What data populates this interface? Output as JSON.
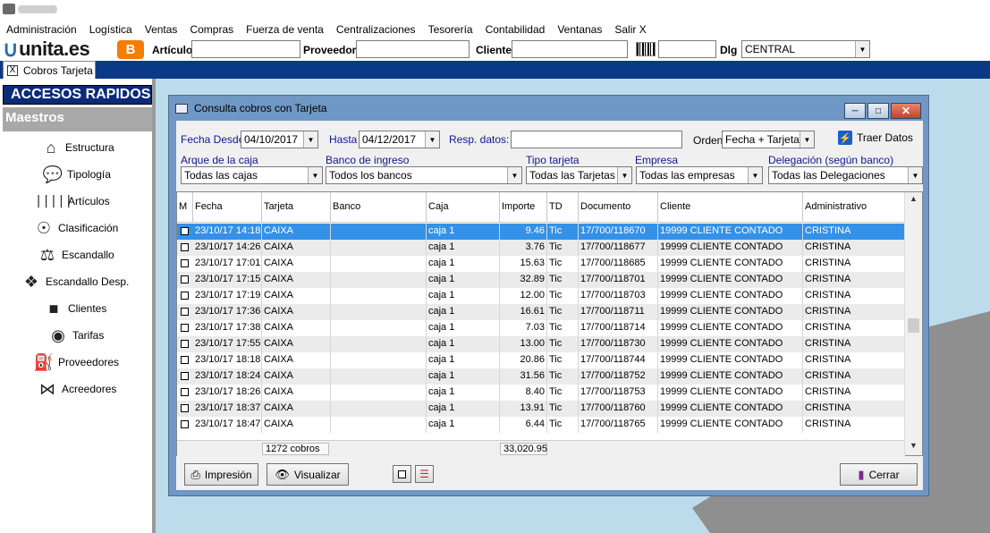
{
  "menubar": [
    "Administración",
    "Logística",
    "Ventas",
    "Compras",
    "Fuerza de venta",
    "Centralizaciones",
    "Tesorería",
    "Contabilidad",
    "Ventanas",
    "Salir X"
  ],
  "toolbar": {
    "logo_text": "unita.es",
    "blogger_glyph": "B",
    "articulo_label": "Artículo",
    "proveedor_label": "Proveedor",
    "cliente_label": "Cliente",
    "dlg_label": "Dlg",
    "dlg_value": "CENTRAL"
  },
  "tab": {
    "label": "Cobros Tarjeta",
    "close_glyph": "X"
  },
  "sidebar": {
    "header": "ACCESOS RAPIDOS",
    "section": "Maestros",
    "items": [
      {
        "label": "Estructura",
        "icon": "house-icon"
      },
      {
        "label": "Tipología",
        "icon": "chat-icon"
      },
      {
        "label": "Artículos",
        "icon": "barcode-icon"
      },
      {
        "label": "Clasificación",
        "icon": "compass-icon"
      },
      {
        "label": "Escandallo",
        "icon": "flask-icon"
      },
      {
        "label": "Escandallo Desp.",
        "icon": "puzzle-icon"
      },
      {
        "label": "Clientes",
        "icon": "briefcase-icon"
      },
      {
        "label": "Tarifas",
        "icon": "disc-icon"
      },
      {
        "label": "Proveedores",
        "icon": "fuel-icon"
      },
      {
        "label": "Acreedores",
        "icon": "bowtie-icon"
      }
    ]
  },
  "window": {
    "title": "Consulta cobros con Tarjeta",
    "fecha_desde_label": "Fecha Desde",
    "fecha_desde": "04/10/2017",
    "hasta_label": "Hasta",
    "hasta": "04/12/2017",
    "resp_label": "Resp. datos:",
    "resp_value": "",
    "orden_label": "Orden",
    "orden_value": "Fecha + Tarjeta",
    "traer_label": "Traer Datos",
    "arque_label": "Arque de la caja",
    "arque_value": "Todas las cajas",
    "banco_label": "Banco de ingreso",
    "banco_value": "Todos los bancos",
    "tipo_label": "Tipo tarjeta",
    "tipo_value": "Todas las Tarjetas",
    "empresa_label": "Empresa",
    "empresa_value": "Todas las empresas",
    "delegacion_label": "Delegación (según banco)",
    "delegacion_value": "Todas las Delegaciones"
  },
  "grid": {
    "columns": [
      "M",
      "Fecha",
      "Tarjeta",
      "Banco",
      "Caja",
      "Importe",
      "TD",
      "Documento",
      "Cliente",
      "Administrativo"
    ],
    "rows": [
      [
        "23/10/17 14:18",
        "CAIXA",
        "",
        "caja 1",
        "9.46",
        "Tic",
        "17/700/118670",
        "19999 CLIENTE CONTADO",
        "CRISTINA"
      ],
      [
        "23/10/17 14:26",
        "CAIXA",
        "",
        "caja 1",
        "3.76",
        "Tic",
        "17/700/118677",
        "19999 CLIENTE CONTADO",
        "CRISTINA"
      ],
      [
        "23/10/17 17:01",
        "CAIXA",
        "",
        "caja 1",
        "15.63",
        "Tic",
        "17/700/118685",
        "19999 CLIENTE CONTADO",
        "CRISTINA"
      ],
      [
        "23/10/17 17:15",
        "CAIXA",
        "",
        "caja 1",
        "32.89",
        "Tic",
        "17/700/118701",
        "19999 CLIENTE CONTADO",
        "CRISTINA"
      ],
      [
        "23/10/17 17:19",
        "CAIXA",
        "",
        "caja 1",
        "12.00",
        "Tic",
        "17/700/118703",
        "19999 CLIENTE CONTADO",
        "CRISTINA"
      ],
      [
        "23/10/17 17:36",
        "CAIXA",
        "",
        "caja 1",
        "16.61",
        "Tic",
        "17/700/118711",
        "19999 CLIENTE CONTADO",
        "CRISTINA"
      ],
      [
        "23/10/17 17:38",
        "CAIXA",
        "",
        "caja 1",
        "7.03",
        "Tic",
        "17/700/118714",
        "19999 CLIENTE CONTADO",
        "CRISTINA"
      ],
      [
        "23/10/17 17:55",
        "CAIXA",
        "",
        "caja 1",
        "13.00",
        "Tic",
        "17/700/118730",
        "19999 CLIENTE CONTADO",
        "CRISTINA"
      ],
      [
        "23/10/17 18:18",
        "CAIXA",
        "",
        "caja 1",
        "20.86",
        "Tic",
        "17/700/118744",
        "19999 CLIENTE CONTADO",
        "CRISTINA"
      ],
      [
        "23/10/17 18:24",
        "CAIXA",
        "",
        "caja 1",
        "31.56",
        "Tic",
        "17/700/118752",
        "19999 CLIENTE CONTADO",
        "CRISTINA"
      ],
      [
        "23/10/17 18:26",
        "CAIXA",
        "",
        "caja 1",
        "8.40",
        "Tic",
        "17/700/118753",
        "19999 CLIENTE CONTADO",
        "CRISTINA"
      ],
      [
        "23/10/17 18:37",
        "CAIXA",
        "",
        "caja 1",
        "13.91",
        "Tic",
        "17/700/118760",
        "19999 CLIENTE CONTADO",
        "CRISTINA"
      ],
      [
        "23/10/17 18:47",
        "CAIXA",
        "",
        "caja 1",
        "6.44",
        "Tic",
        "17/700/118765",
        "19999 CLIENTE CONTADO",
        "CRISTINA"
      ]
    ],
    "selected_row": 0,
    "footer_count": "1272 cobros",
    "footer_total": "33,020.95"
  },
  "buttons": {
    "impresion": "Impresión",
    "visualizar": "Visualizar",
    "cerrar": "Cerrar"
  },
  "colors": {
    "accent_dark_blue": "#0a3a86",
    "selection_blue": "#3391e8",
    "window_frame": "#6f98c4",
    "label_blue": "#101890"
  }
}
